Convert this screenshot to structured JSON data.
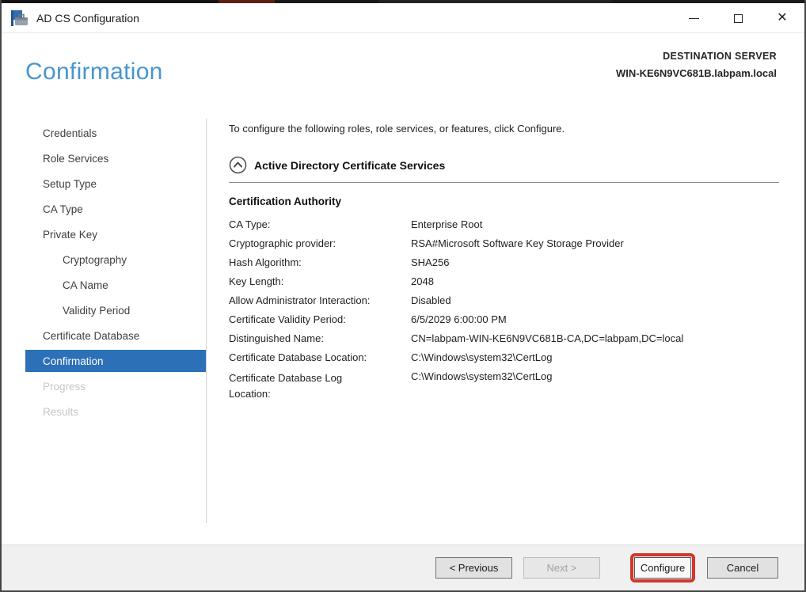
{
  "window": {
    "title": "AD CS Configuration",
    "icons": {
      "app": "server-manager-toolbox-icon",
      "minimize": "minimize-icon",
      "maximize": "maximize-icon",
      "close": "close-icon"
    }
  },
  "header": {
    "page_title": "Confirmation",
    "destination_label": "DESTINATION SERVER",
    "server_name": "WIN-KE6N9VC681B.labpam.local"
  },
  "sidebar": {
    "items": [
      {
        "label": "Credentials",
        "state": "normal",
        "indent": false
      },
      {
        "label": "Role Services",
        "state": "normal",
        "indent": false
      },
      {
        "label": "Setup Type",
        "state": "normal",
        "indent": false
      },
      {
        "label": "CA Type",
        "state": "normal",
        "indent": false
      },
      {
        "label": "Private Key",
        "state": "normal",
        "indent": false
      },
      {
        "label": "Cryptography",
        "state": "normal",
        "indent": true
      },
      {
        "label": "CA Name",
        "state": "normal",
        "indent": true
      },
      {
        "label": "Validity Period",
        "state": "normal",
        "indent": true
      },
      {
        "label": "Certificate Database",
        "state": "normal",
        "indent": false
      },
      {
        "label": "Confirmation",
        "state": "selected",
        "indent": false
      },
      {
        "label": "Progress",
        "state": "disabled",
        "indent": false
      },
      {
        "label": "Results",
        "state": "disabled",
        "indent": false
      }
    ]
  },
  "content": {
    "message": "To configure the following roles, role services, or features, click Configure.",
    "section_title": "Active Directory Certificate Services",
    "section_icon": "chevron-up-circle-icon",
    "group_title": "Certification Authority",
    "rows": [
      {
        "label": "CA Type:",
        "value": "Enterprise Root"
      },
      {
        "label": "Cryptographic provider:",
        "value": "RSA#Microsoft Software Key Storage Provider"
      },
      {
        "label": "Hash Algorithm:",
        "value": "SHA256"
      },
      {
        "label": "Key Length:",
        "value": "2048"
      },
      {
        "label": "Allow Administrator Interaction:",
        "value": "Disabled"
      },
      {
        "label": "Certificate Validity Period:",
        "value": "6/5/2029 6:00:00 PM"
      },
      {
        "label": "Distinguished Name:",
        "value": "CN=labpam-WIN-KE6N9VC681B-CA,DC=labpam,DC=local"
      },
      {
        "label": "Certificate Database Location:",
        "value": "C:\\Windows\\system32\\CertLog"
      },
      {
        "label": "Certificate Database Log Location:",
        "value": "C:\\Windows\\system32\\CertLog"
      }
    ]
  },
  "footer": {
    "previous_label": "< Previous",
    "next_label": "Next >",
    "configure_label": "Configure",
    "cancel_label": "Cancel"
  },
  "colors": {
    "heading_blue": "#4796ce",
    "selection_blue": "#2c70b8",
    "annotation_red": "#d2362c",
    "footer_gray": "#f0f0f0"
  }
}
